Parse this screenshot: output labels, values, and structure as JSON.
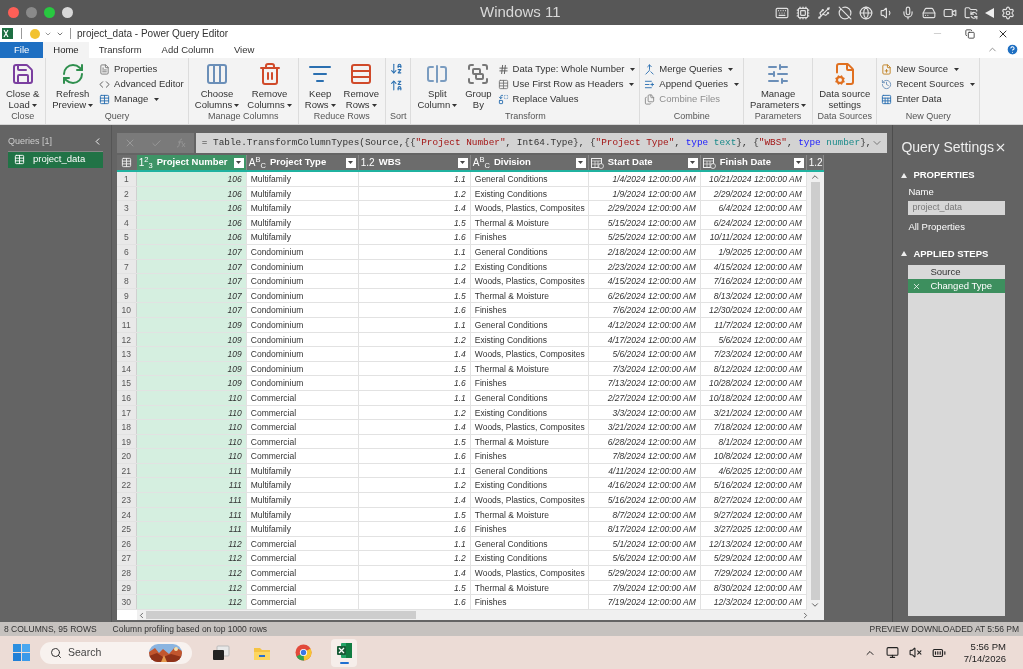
{
  "mac_bar": {
    "title": "Windows 11"
  },
  "window": {
    "title": "project_data - Power Query Editor"
  },
  "tabs": [
    {
      "label": "File",
      "kind": "file",
      "selected": false
    },
    {
      "label": "Home",
      "kind": "tab",
      "selected": true
    },
    {
      "label": "Transform",
      "kind": "tab",
      "selected": false
    },
    {
      "label": "Add Column",
      "kind": "tab",
      "selected": false
    },
    {
      "label": "View",
      "kind": "tab",
      "selected": false
    }
  ],
  "ribbon": [
    {
      "label": "Close",
      "items": [
        {
          "kind": "large",
          "lines": [
            "Close &",
            "Load"
          ],
          "dropdown": true
        }
      ]
    },
    {
      "label": "Query",
      "items": [
        {
          "kind": "large",
          "lines": [
            "Refresh",
            "Preview"
          ],
          "dropdown": true
        },
        {
          "kind": "stack",
          "buttons": [
            {
              "label": "Properties",
              "dropdown": false,
              "disabled": false
            },
            {
              "label": "Advanced Editor",
              "dropdown": false,
              "disabled": false
            },
            {
              "label": "Manage",
              "dropdown": true,
              "disabled": false
            }
          ]
        }
      ]
    },
    {
      "label": "Manage Columns",
      "items": [
        {
          "kind": "large",
          "lines": [
            "Choose",
            "Columns"
          ],
          "dropdown": true
        },
        {
          "kind": "large",
          "lines": [
            "Remove",
            "Columns"
          ],
          "dropdown": true
        }
      ]
    },
    {
      "label": "Reduce Rows",
      "items": [
        {
          "kind": "large",
          "lines": [
            "Keep",
            "Rows"
          ],
          "dropdown": true
        },
        {
          "kind": "large",
          "lines": [
            "Remove",
            "Rows"
          ],
          "dropdown": true
        }
      ]
    },
    {
      "label": "Sort",
      "items": [
        {
          "kind": "icons"
        }
      ]
    },
    {
      "label": "Transform",
      "items": [
        {
          "kind": "large",
          "lines": [
            "Split",
            "Column"
          ],
          "dropdown": true
        },
        {
          "kind": "large",
          "lines": [
            "Group",
            "By"
          ],
          "dropdown": false
        },
        {
          "kind": "stack",
          "buttons": [
            {
              "label": "Data Type: Whole Number",
              "dropdown": true,
              "disabled": false
            },
            {
              "label": "Use First Row as Headers",
              "dropdown": true,
              "disabled": false
            },
            {
              "label": "Replace Values",
              "dropdown": false,
              "disabled": false
            }
          ]
        }
      ]
    },
    {
      "label": "Combine",
      "items": [
        {
          "kind": "stack",
          "buttons": [
            {
              "label": "Merge Queries",
              "dropdown": true,
              "disabled": false
            },
            {
              "label": "Append Queries",
              "dropdown": true,
              "disabled": false
            },
            {
              "label": "Combine Files",
              "dropdown": false,
              "disabled": true
            }
          ]
        }
      ]
    },
    {
      "label": "Parameters",
      "items": [
        {
          "kind": "large",
          "lines": [
            "Manage",
            "Parameters"
          ],
          "dropdown": true
        }
      ]
    },
    {
      "label": "Data Sources",
      "items": [
        {
          "kind": "large",
          "lines": [
            "Data source",
            "settings"
          ],
          "dropdown": false
        }
      ]
    },
    {
      "label": "New Query",
      "items": [
        {
          "kind": "stack",
          "buttons": [
            {
              "label": "New Source",
              "dropdown": true,
              "disabled": false
            },
            {
              "label": "Recent Sources",
              "dropdown": true,
              "disabled": false
            },
            {
              "label": "Enter Data",
              "dropdown": false,
              "disabled": false
            }
          ]
        }
      ]
    }
  ],
  "queries": {
    "title": "Queries [1]",
    "items": [
      {
        "name": "project_data",
        "selected": true
      }
    ]
  },
  "formula": [
    {
      "kind": "plain",
      "text": "= Table.TransformColumnTypes(Source,{{"
    },
    {
      "kind": "string",
      "text": "\"Project Number\""
    },
    {
      "kind": "plain",
      "text": ", Int64.Type}, {"
    },
    {
      "kind": "string",
      "text": "\"Project Type\""
    },
    {
      "kind": "plain",
      "text": ", "
    },
    {
      "kind": "keyword",
      "text": "type"
    },
    {
      "kind": "typename",
      "text": " text"
    },
    {
      "kind": "plain",
      "text": "}, {"
    },
    {
      "kind": "string",
      "text": "\"WBS\""
    },
    {
      "kind": "plain",
      "text": ", "
    },
    {
      "kind": "keyword",
      "text": "type"
    },
    {
      "kind": "typename",
      "text": " number"
    },
    {
      "kind": "plain",
      "text": "},"
    }
  ],
  "table": {
    "columns": [
      {
        "name": "Project Number",
        "kind": "number",
        "type_label": "1$^{2}$$_{3}$",
        "selected": true
      },
      {
        "name": "Project Type",
        "kind": "text",
        "type_label": "A$^{B}$$_{C}$",
        "selected": false
      },
      {
        "name": "WBS",
        "kind": "number",
        "type_label": "1.2",
        "selected": false
      },
      {
        "name": "Division",
        "kind": "text",
        "type_label": "A$^{B}$$_{C}$",
        "selected": false
      },
      {
        "name": "Start Date",
        "kind": "date",
        "selected": false
      },
      {
        "name": "Finish Date",
        "kind": "date",
        "selected": false
      },
      {
        "kind": "number",
        "type_label": "1.2",
        "selected": false
      }
    ],
    "rows": [
      {
        "n": "1",
        "cells": [
          "106",
          "Multifamily",
          "1.1",
          "General Conditions",
          "1/4/2024 12:00:00 AM",
          "10/21/2024 12:00:00 AM"
        ]
      },
      {
        "n": "2",
        "cells": [
          "106",
          "Multifamily",
          "1.2",
          "Existing Conditions",
          "1/9/2024 12:00:00 AM",
          "2/29/2024 12:00:00 AM"
        ]
      },
      {
        "n": "3",
        "cells": [
          "106",
          "Multifamily",
          "1.4",
          "Woods, Plastics, Composites",
          "2/29/2024 12:00:00 AM",
          "6/4/2024 12:00:00 AM"
        ]
      },
      {
        "n": "4",
        "cells": [
          "106",
          "Multifamily",
          "1.5",
          "Thermal & Moisture",
          "5/15/2024 12:00:00 AM",
          "6/24/2024 12:00:00 AM"
        ]
      },
      {
        "n": "5",
        "cells": [
          "106",
          "Multifamily",
          "1.6",
          "Finishes",
          "5/25/2024 12:00:00 AM",
          "10/11/2024 12:00:00 AM"
        ]
      },
      {
        "n": "6",
        "cells": [
          "107",
          "Condominium",
          "1.1",
          "General Conditions",
          "2/18/2024 12:00:00 AM",
          "1/9/2025 12:00:00 AM"
        ]
      },
      {
        "n": "7",
        "cells": [
          "107",
          "Condominium",
          "1.2",
          "Existing Conditions",
          "2/23/2024 12:00:00 AM",
          "4/15/2024 12:00:00 AM"
        ]
      },
      {
        "n": "8",
        "cells": [
          "107",
          "Condominium",
          "1.4",
          "Woods, Plastics, Composites",
          "4/15/2024 12:00:00 AM",
          "7/16/2024 12:00:00 AM"
        ]
      },
      {
        "n": "9",
        "cells": [
          "107",
          "Condominium",
          "1.5",
          "Thermal & Moisture",
          "6/26/2024 12:00:00 AM",
          "8/13/2024 12:00:00 AM"
        ]
      },
      {
        "n": "10",
        "cells": [
          "107",
          "Condominium",
          "1.6",
          "Finishes",
          "7/6/2024 12:00:00 AM",
          "12/30/2024 12:00:00 AM"
        ]
      },
      {
        "n": "11",
        "cells": [
          "109",
          "Condominium",
          "1.1",
          "General Conditions",
          "4/12/2024 12:00:00 AM",
          "11/7/2024 12:00:00 AM"
        ]
      },
      {
        "n": "12",
        "cells": [
          "109",
          "Condominium",
          "1.2",
          "Existing Conditions",
          "4/17/2024 12:00:00 AM",
          "5/6/2024 12:00:00 AM"
        ]
      },
      {
        "n": "13",
        "cells": [
          "109",
          "Condominium",
          "1.4",
          "Woods, Plastics, Composites",
          "5/6/2024 12:00:00 AM",
          "7/23/2024 12:00:00 AM"
        ]
      },
      {
        "n": "14",
        "cells": [
          "109",
          "Condominium",
          "1.5",
          "Thermal & Moisture",
          "7/3/2024 12:00:00 AM",
          "8/12/2024 12:00:00 AM"
        ]
      },
      {
        "n": "15",
        "cells": [
          "109",
          "Condominium",
          "1.6",
          "Finishes",
          "7/13/2024 12:00:00 AM",
          "10/28/2024 12:00:00 AM"
        ]
      },
      {
        "n": "16",
        "cells": [
          "110",
          "Commercial",
          "1.1",
          "General Conditions",
          "2/27/2024 12:00:00 AM",
          "10/18/2024 12:00:00 AM"
        ]
      },
      {
        "n": "17",
        "cells": [
          "110",
          "Commercial",
          "1.2",
          "Existing Conditions",
          "3/3/2024 12:00:00 AM",
          "3/21/2024 12:00:00 AM"
        ]
      },
      {
        "n": "18",
        "cells": [
          "110",
          "Commercial",
          "1.4",
          "Woods, Plastics, Composites",
          "3/21/2024 12:00:00 AM",
          "7/18/2024 12:00:00 AM"
        ]
      },
      {
        "n": "19",
        "cells": [
          "110",
          "Commercial",
          "1.5",
          "Thermal & Moisture",
          "6/28/2024 12:00:00 AM",
          "8/1/2024 12:00:00 AM"
        ]
      },
      {
        "n": "20",
        "cells": [
          "110",
          "Commercial",
          "1.6",
          "Finishes",
          "7/8/2024 12:00:00 AM",
          "10/8/2024 12:00:00 AM"
        ]
      },
      {
        "n": "21",
        "cells": [
          "111",
          "Multifamily",
          "1.1",
          "General Conditions",
          "4/11/2024 12:00:00 AM",
          "4/6/2025 12:00:00 AM"
        ]
      },
      {
        "n": "22",
        "cells": [
          "111",
          "Multifamily",
          "1.2",
          "Existing Conditions",
          "4/16/2024 12:00:00 AM",
          "5/16/2024 12:00:00 AM"
        ]
      },
      {
        "n": "23",
        "cells": [
          "111",
          "Multifamily",
          "1.4",
          "Woods, Plastics, Composites",
          "5/16/2024 12:00:00 AM",
          "8/27/2024 12:00:00 AM"
        ]
      },
      {
        "n": "24",
        "cells": [
          "111",
          "Multifamily",
          "1.5",
          "Thermal & Moisture",
          "8/7/2024 12:00:00 AM",
          "9/27/2024 12:00:00 AM"
        ]
      },
      {
        "n": "25",
        "cells": [
          "111",
          "Multifamily",
          "1.6",
          "Finishes",
          "8/17/2024 12:00:00 AM",
          "3/27/2025 12:00:00 AM"
        ]
      },
      {
        "n": "26",
        "cells": [
          "112",
          "Commercial",
          "1.1",
          "General Conditions",
          "5/1/2024 12:00:00 AM",
          "12/13/2024 12:00:00 AM"
        ]
      },
      {
        "n": "27",
        "cells": [
          "112",
          "Commercial",
          "1.2",
          "Existing Conditions",
          "5/6/2024 12:00:00 AM",
          "5/29/2024 12:00:00 AM"
        ]
      },
      {
        "n": "28",
        "cells": [
          "112",
          "Commercial",
          "1.4",
          "Woods, Plastics, Composites",
          "5/29/2024 12:00:00 AM",
          "7/29/2024 12:00:00 AM"
        ]
      },
      {
        "n": "29",
        "cells": [
          "112",
          "Commercial",
          "1.5",
          "Thermal & Moisture",
          "7/9/2024 12:00:00 AM",
          "8/30/2024 12:00:00 AM"
        ]
      },
      {
        "n": "30",
        "cells": [
          "112",
          "Commercial",
          "1.6",
          "Finishes",
          "7/19/2024 12:00:00 AM",
          "12/3/2024 12:00:00 AM"
        ]
      }
    ]
  },
  "query_settings": {
    "title": "Query Settings",
    "properties": {
      "heading": "PROPERTIES",
      "expanded": true,
      "name_label": "Name",
      "name_value": "project_data",
      "link": "All Properties"
    },
    "steps": {
      "heading": "APPLIED STEPS",
      "expanded": true,
      "items": [
        {
          "label": "Source",
          "selected": false
        },
        {
          "label": "Changed Type",
          "selected": true
        }
      ]
    }
  },
  "status_bar": {
    "left": [
      "8 COLUMNS, 95 ROWS",
      "Column profiling based on top 1000 rows"
    ],
    "right": "PREVIEW DOWNLOADED AT 5:56 PM"
  },
  "taskbar": {
    "search": "Search",
    "apps": [
      {
        "kind": "taskview",
        "active": false
      },
      {
        "kind": "explorer",
        "active": false
      },
      {
        "kind": "chrome",
        "active": false
      },
      {
        "kind": "excel",
        "active": true
      }
    ],
    "time": "5:56 PM",
    "date": "7/14/2026"
  }
}
